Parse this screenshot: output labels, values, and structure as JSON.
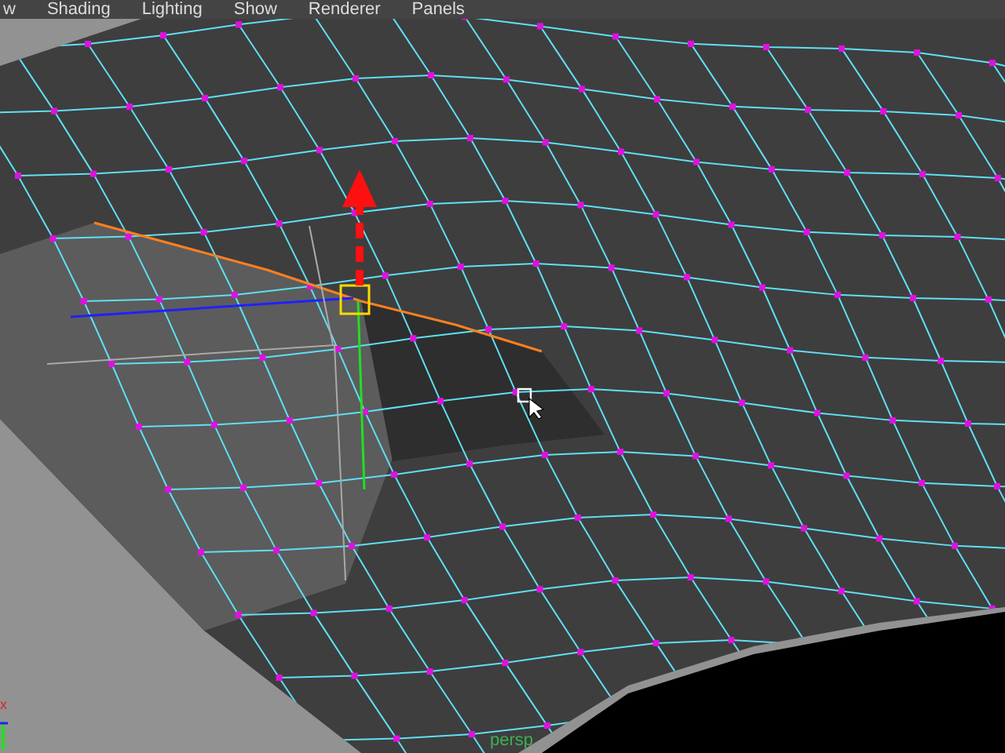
{
  "menu_bar": {
    "items": [
      {
        "label": "w"
      },
      {
        "label": "Shading"
      },
      {
        "label": "Lighting"
      },
      {
        "label": "Show"
      },
      {
        "label": "Renderer"
      },
      {
        "label": "Panels"
      }
    ]
  },
  "viewport": {
    "axis_label": "x",
    "camera_label": "persp"
  }
}
